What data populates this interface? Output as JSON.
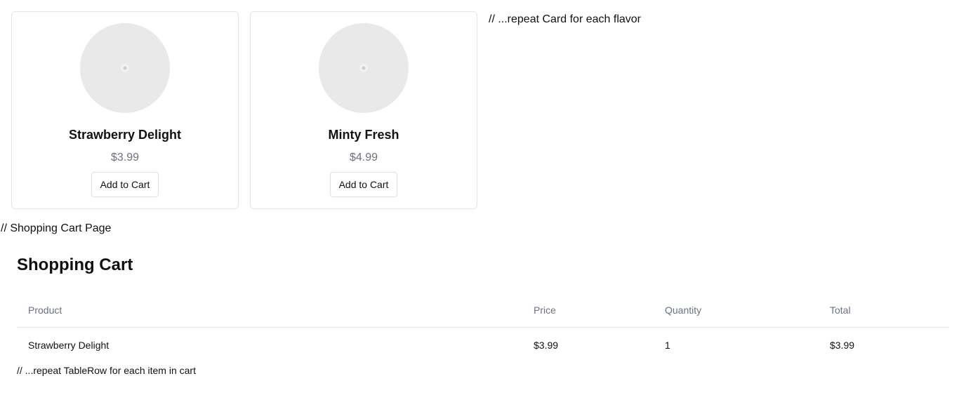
{
  "products": [
    {
      "name": "Strawberry Delight",
      "price": "$3.99",
      "button_label": "Add to Cart"
    },
    {
      "name": "Minty Fresh",
      "price": "$4.99",
      "button_label": "Add to Cart"
    }
  ],
  "comments": {
    "repeat_card": "// ...repeat Card for each flavor",
    "cart_page": "// Shopping Cart Page",
    "repeat_row": "// ...repeat TableRow for each item in cart"
  },
  "cart": {
    "title": "Shopping Cart",
    "columns": [
      "Product",
      "Price",
      "Quantity",
      "Total"
    ],
    "rows": [
      {
        "product": "Strawberry Delight",
        "price": "$3.99",
        "quantity": "1",
        "total": "$3.99"
      }
    ]
  },
  "colors": {
    "muted_text": "#6b7280",
    "border": "#e3e3e3",
    "avatar_bg": "#e9e9e9"
  }
}
